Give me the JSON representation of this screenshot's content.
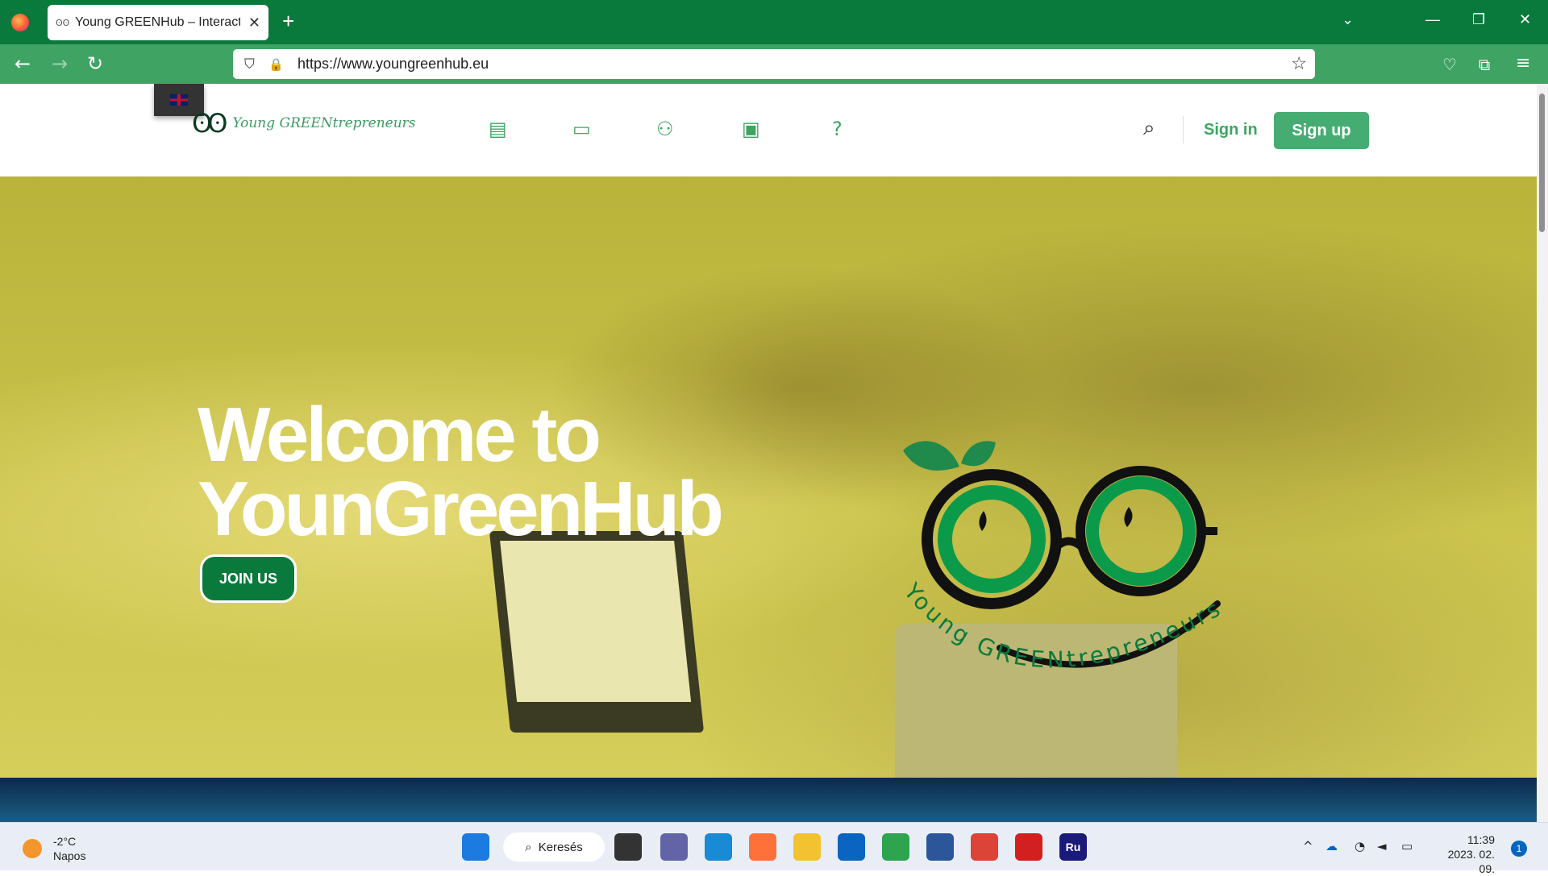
{
  "browser": {
    "tab_title": "Young GREENHub – Interactive",
    "tab_favicon": "ʘʘ",
    "tab_close": "✕",
    "new_tab": "+",
    "url": "https://www.youngreenhub.eu",
    "window_controls": {
      "list": "⌄",
      "minimize": "—",
      "restore": "❐",
      "close": "✕"
    },
    "nav": {
      "back": "←",
      "forward": "→",
      "reload": "↻"
    },
    "url_icons": {
      "shield": "⛉",
      "lock": "🔒",
      "bookmark": "☆"
    },
    "toolbar_icons": {
      "pocket": "♡",
      "extensions": "⧉",
      "menu": "≡"
    }
  },
  "site": {
    "logo_text": "Young GREENtrepreneurs",
    "logo_glasses": "ʘʘ",
    "nav_icons": [
      {
        "name": "courses",
        "glyph": "▤"
      },
      {
        "name": "monitor",
        "glyph": "▭"
      },
      {
        "name": "community",
        "glyph": "⚇"
      },
      {
        "name": "id-card",
        "glyph": "▣"
      },
      {
        "name": "help",
        "glyph": "?"
      }
    ],
    "search_glyph": "⌕",
    "signin_label": "Sign in",
    "signup_label": "Sign up",
    "hero_title_line1": "Welcome to",
    "hero_title_line2": "YounGreenHub",
    "join_label": "JOIN US",
    "hero_logo_text": "Young GREENtrepreneurs"
  },
  "taskbar": {
    "weather_temp": "-2°C",
    "weather_desc": "Napos",
    "search_label": "Keresés",
    "search_glyph": "⌕",
    "apps": [
      {
        "name": "windows-start",
        "label": "",
        "color": "#1c7be0"
      },
      {
        "name": "task-view",
        "label": "",
        "color": "#333333"
      },
      {
        "name": "teams",
        "label": "",
        "color": "#6264a7"
      },
      {
        "name": "edge",
        "label": "",
        "color": "#1a8ad4"
      },
      {
        "name": "firefox",
        "label": "",
        "color": "#ff7139"
      },
      {
        "name": "file-explorer",
        "label": "",
        "color": "#f2c230"
      },
      {
        "name": "outlook",
        "label": "",
        "color": "#0a64c2"
      },
      {
        "name": "chrome",
        "label": "",
        "color": "#2ea44f"
      },
      {
        "name": "word",
        "label": "",
        "color": "#2b579a"
      },
      {
        "name": "chrome-profile",
        "label": "",
        "color": "#db4437"
      },
      {
        "name": "acrobat",
        "label": "",
        "color": "#d21f1f"
      },
      {
        "name": "robohelp",
        "label": "Ru",
        "color": "#1a1a7a"
      }
    ],
    "tray": {
      "chevron": "^",
      "cloud": "☁",
      "wifi": "◔",
      "volume": "◄",
      "battery": "▭"
    },
    "time": "11:39",
    "date": "2023. 02. 09.",
    "notification_count": "1"
  }
}
